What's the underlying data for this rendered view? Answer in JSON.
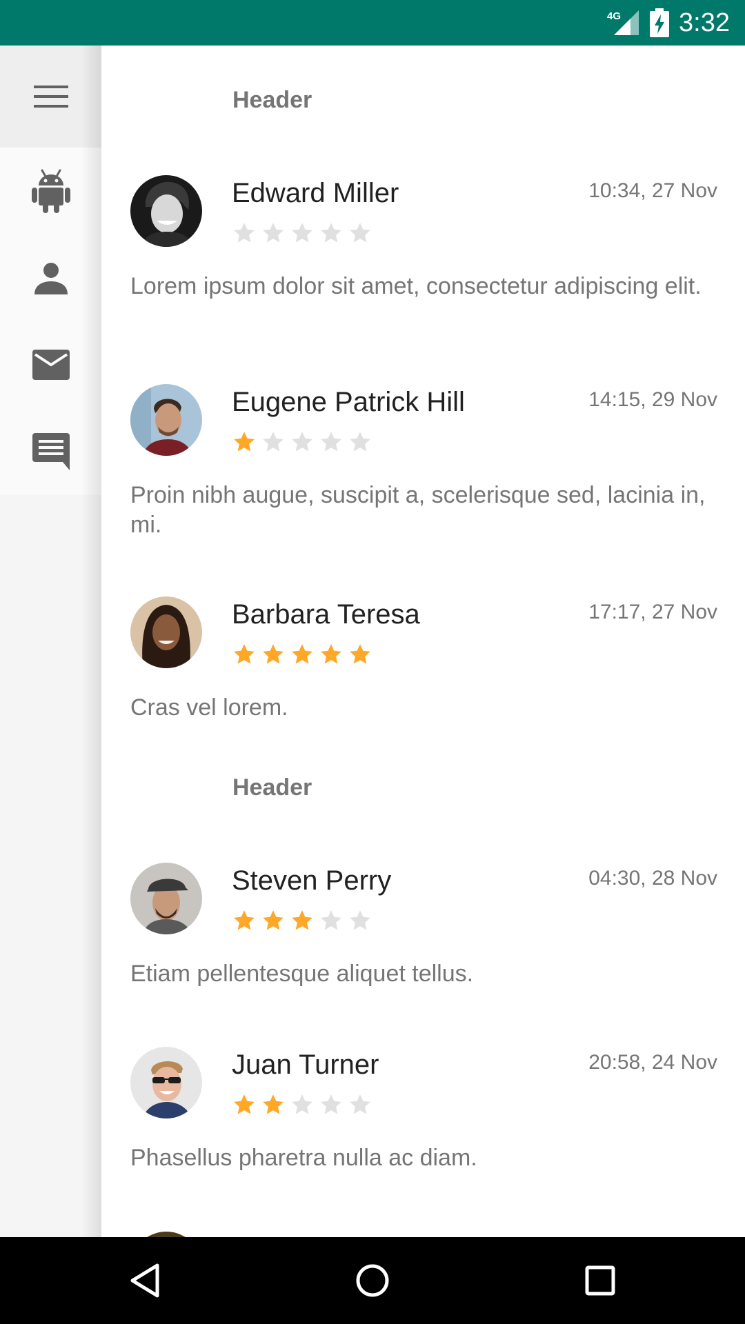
{
  "status_bar": {
    "time": "3:32",
    "network": "4G",
    "signal_icon": "signal-icon",
    "battery_icon": "battery-charging-icon"
  },
  "rail": {
    "menu_icon": "menu-icon",
    "items": [
      {
        "icon": "android-icon"
      },
      {
        "icon": "person-icon"
      },
      {
        "icon": "mail-icon"
      },
      {
        "icon": "message-icon"
      }
    ]
  },
  "list": {
    "sections": [
      {
        "header": "Header",
        "items": [
          {
            "name": "Edward Miller",
            "time": "10:34, 27 Nov",
            "rating": 0,
            "message": "Lorem ipsum dolor sit amet, consectetur adipiscing elit."
          },
          {
            "name": "Eugene Patrick Hill",
            "time": "14:15, 29 Nov",
            "rating": 1,
            "message": "Proin nibh augue, suscipit a, scelerisque sed, lacinia in, mi."
          },
          {
            "name": "Barbara Teresa",
            "time": "17:17, 27 Nov",
            "rating": 5,
            "message": "Cras vel lorem."
          }
        ]
      },
      {
        "header": "Header",
        "items": [
          {
            "name": "Steven Perry",
            "time": "04:30, 28 Nov",
            "rating": 3,
            "message": "Etiam pellentesque aliquet tellus."
          },
          {
            "name": "Juan Turner",
            "time": "20:58, 24 Nov",
            "rating": 2,
            "message": "Phasellus pharetra nulla ac diam."
          }
        ]
      }
    ],
    "max_rating": 5
  },
  "colors": {
    "status_bar": "#00796B",
    "star_on": "#FFA726",
    "star_off": "#E0E0E0",
    "icon": "#616161"
  },
  "nav_bar": {
    "back_icon": "back-icon",
    "home_icon": "home-icon",
    "recents_icon": "recents-icon"
  }
}
